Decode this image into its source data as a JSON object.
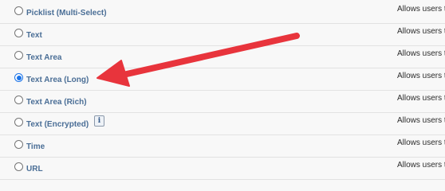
{
  "field_types": [
    {
      "label": "Picklist (Multi-Select)",
      "description": "Allows users t",
      "selected": false
    },
    {
      "label": "Text",
      "description": "Allows users t",
      "selected": false
    },
    {
      "label": "Text Area",
      "description": "Allows users t",
      "selected": false
    },
    {
      "label": "Text Area (Long)",
      "description": "Allows users t",
      "selected": true
    },
    {
      "label": "Text Area (Rich)",
      "description": "Allows users t",
      "selected": false
    },
    {
      "label": "Text (Encrypted)",
      "description": "Allows users t",
      "selected": false,
      "info_icon": "i"
    },
    {
      "label": "Time",
      "description": "Allows users t",
      "selected": false
    },
    {
      "label": "URL",
      "description": "Allows users t",
      "selected": false
    }
  ],
  "colors": {
    "link_label": "#4a6e96",
    "radio_selected": "#1a73e8",
    "annotation_arrow": "#e8343c"
  },
  "annotation": {
    "icon": "red-arrow-pointing-left"
  }
}
